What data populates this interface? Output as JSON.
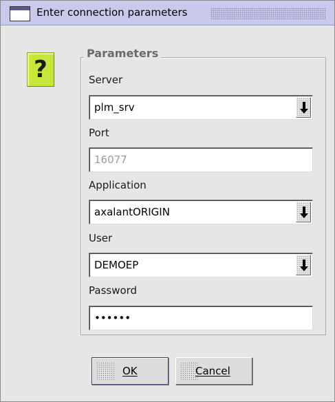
{
  "window": {
    "title": "Enter connection parameters",
    "title_bar_color": "#c9c9ec"
  },
  "help_icon": {
    "glyph": "?",
    "color": "#c6e83a"
  },
  "group": {
    "legend": "Parameters"
  },
  "fields": {
    "server": {
      "label": "Server",
      "value": "plm_srv",
      "type": "combobox"
    },
    "port": {
      "label": "Port",
      "value": "16077",
      "type": "text",
      "enabled": false
    },
    "application": {
      "label": "Application",
      "value": "axalantORIGIN",
      "type": "combobox"
    },
    "user": {
      "label": "User",
      "value": "DEMOEP",
      "type": "combobox"
    },
    "password": {
      "label": "Password",
      "value": "••••••",
      "type": "password"
    }
  },
  "buttons": {
    "ok": "OK",
    "cancel": "Cancel"
  }
}
